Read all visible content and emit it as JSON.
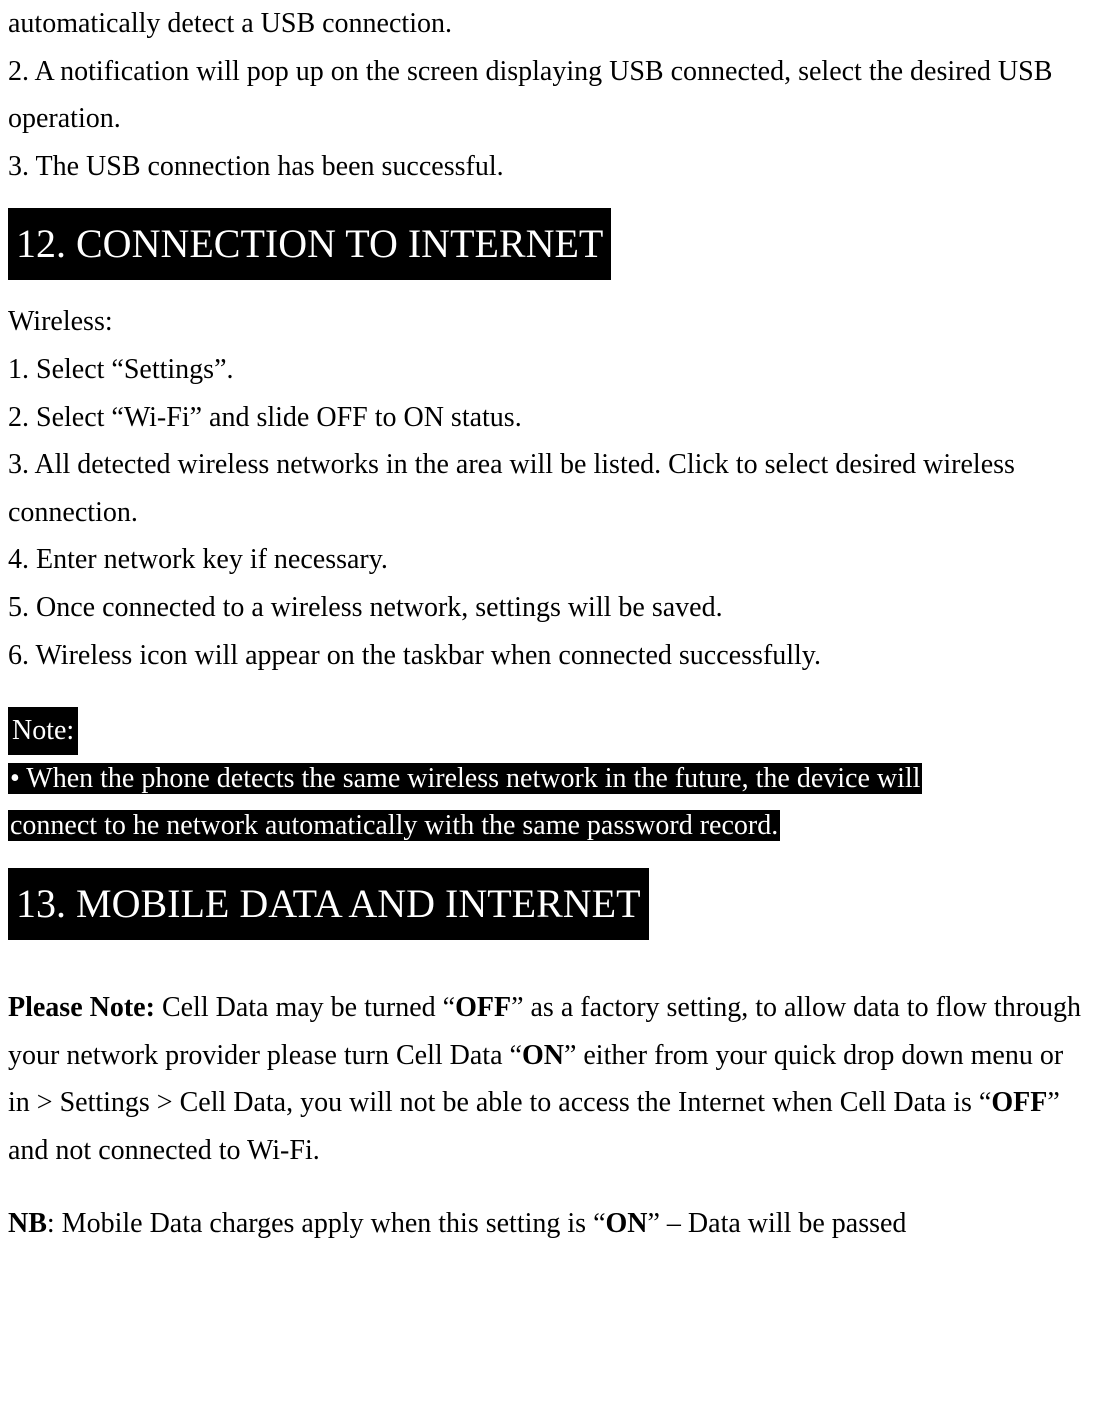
{
  "intro": {
    "line1": "automatically detect a USB connection.",
    "line2": "2. A notification will pop up on the screen displaying USB connected, select the desired USB operation.",
    "line3": "3. The USB connection has been successful."
  },
  "section12": {
    "heading": "12. CONNECTION TO INTERNET",
    "lines": [
      "Wireless:",
      "1. Select “Settings”.",
      "2. Select “Wi-Fi” and slide OFF to ON status.",
      "3. All detected wireless networks in the area will be listed. Click to select desired wireless connection.",
      "4. Enter network key if necessary.",
      "5. Once connected to a wireless network, settings will be saved.",
      "6. Wireless icon will appear on the taskbar when connected successfully."
    ],
    "note_label": "Note:",
    "note_line1": "• When the phone detects the same wireless network in the future, the device will",
    "note_line2": "connect to he network automatically with the same password record."
  },
  "section13": {
    "heading": "13. MOBILE DATA AND INTERNET",
    "please_note_label": "Please Note:",
    "please_note_p1a": " Cell Data may be turned “",
    "off1": "OFF",
    "please_note_p1b": "” as a factory setting, to allow data to flow through your network provider please turn Cell Data “",
    "on1": "ON",
    "please_note_p1c": "” either from your quick drop down menu or in > Settings > Cell Data, you will not be able to access the Internet when Cell Data is “",
    "off2": "OFF",
    "please_note_p1d": "” and not connected to Wi-Fi.",
    "nb_label": "NB",
    "nb_p_a": ": Mobile Data charges apply when this setting is “",
    "on2": "ON",
    "nb_p_b": "” – Data will be passed"
  }
}
